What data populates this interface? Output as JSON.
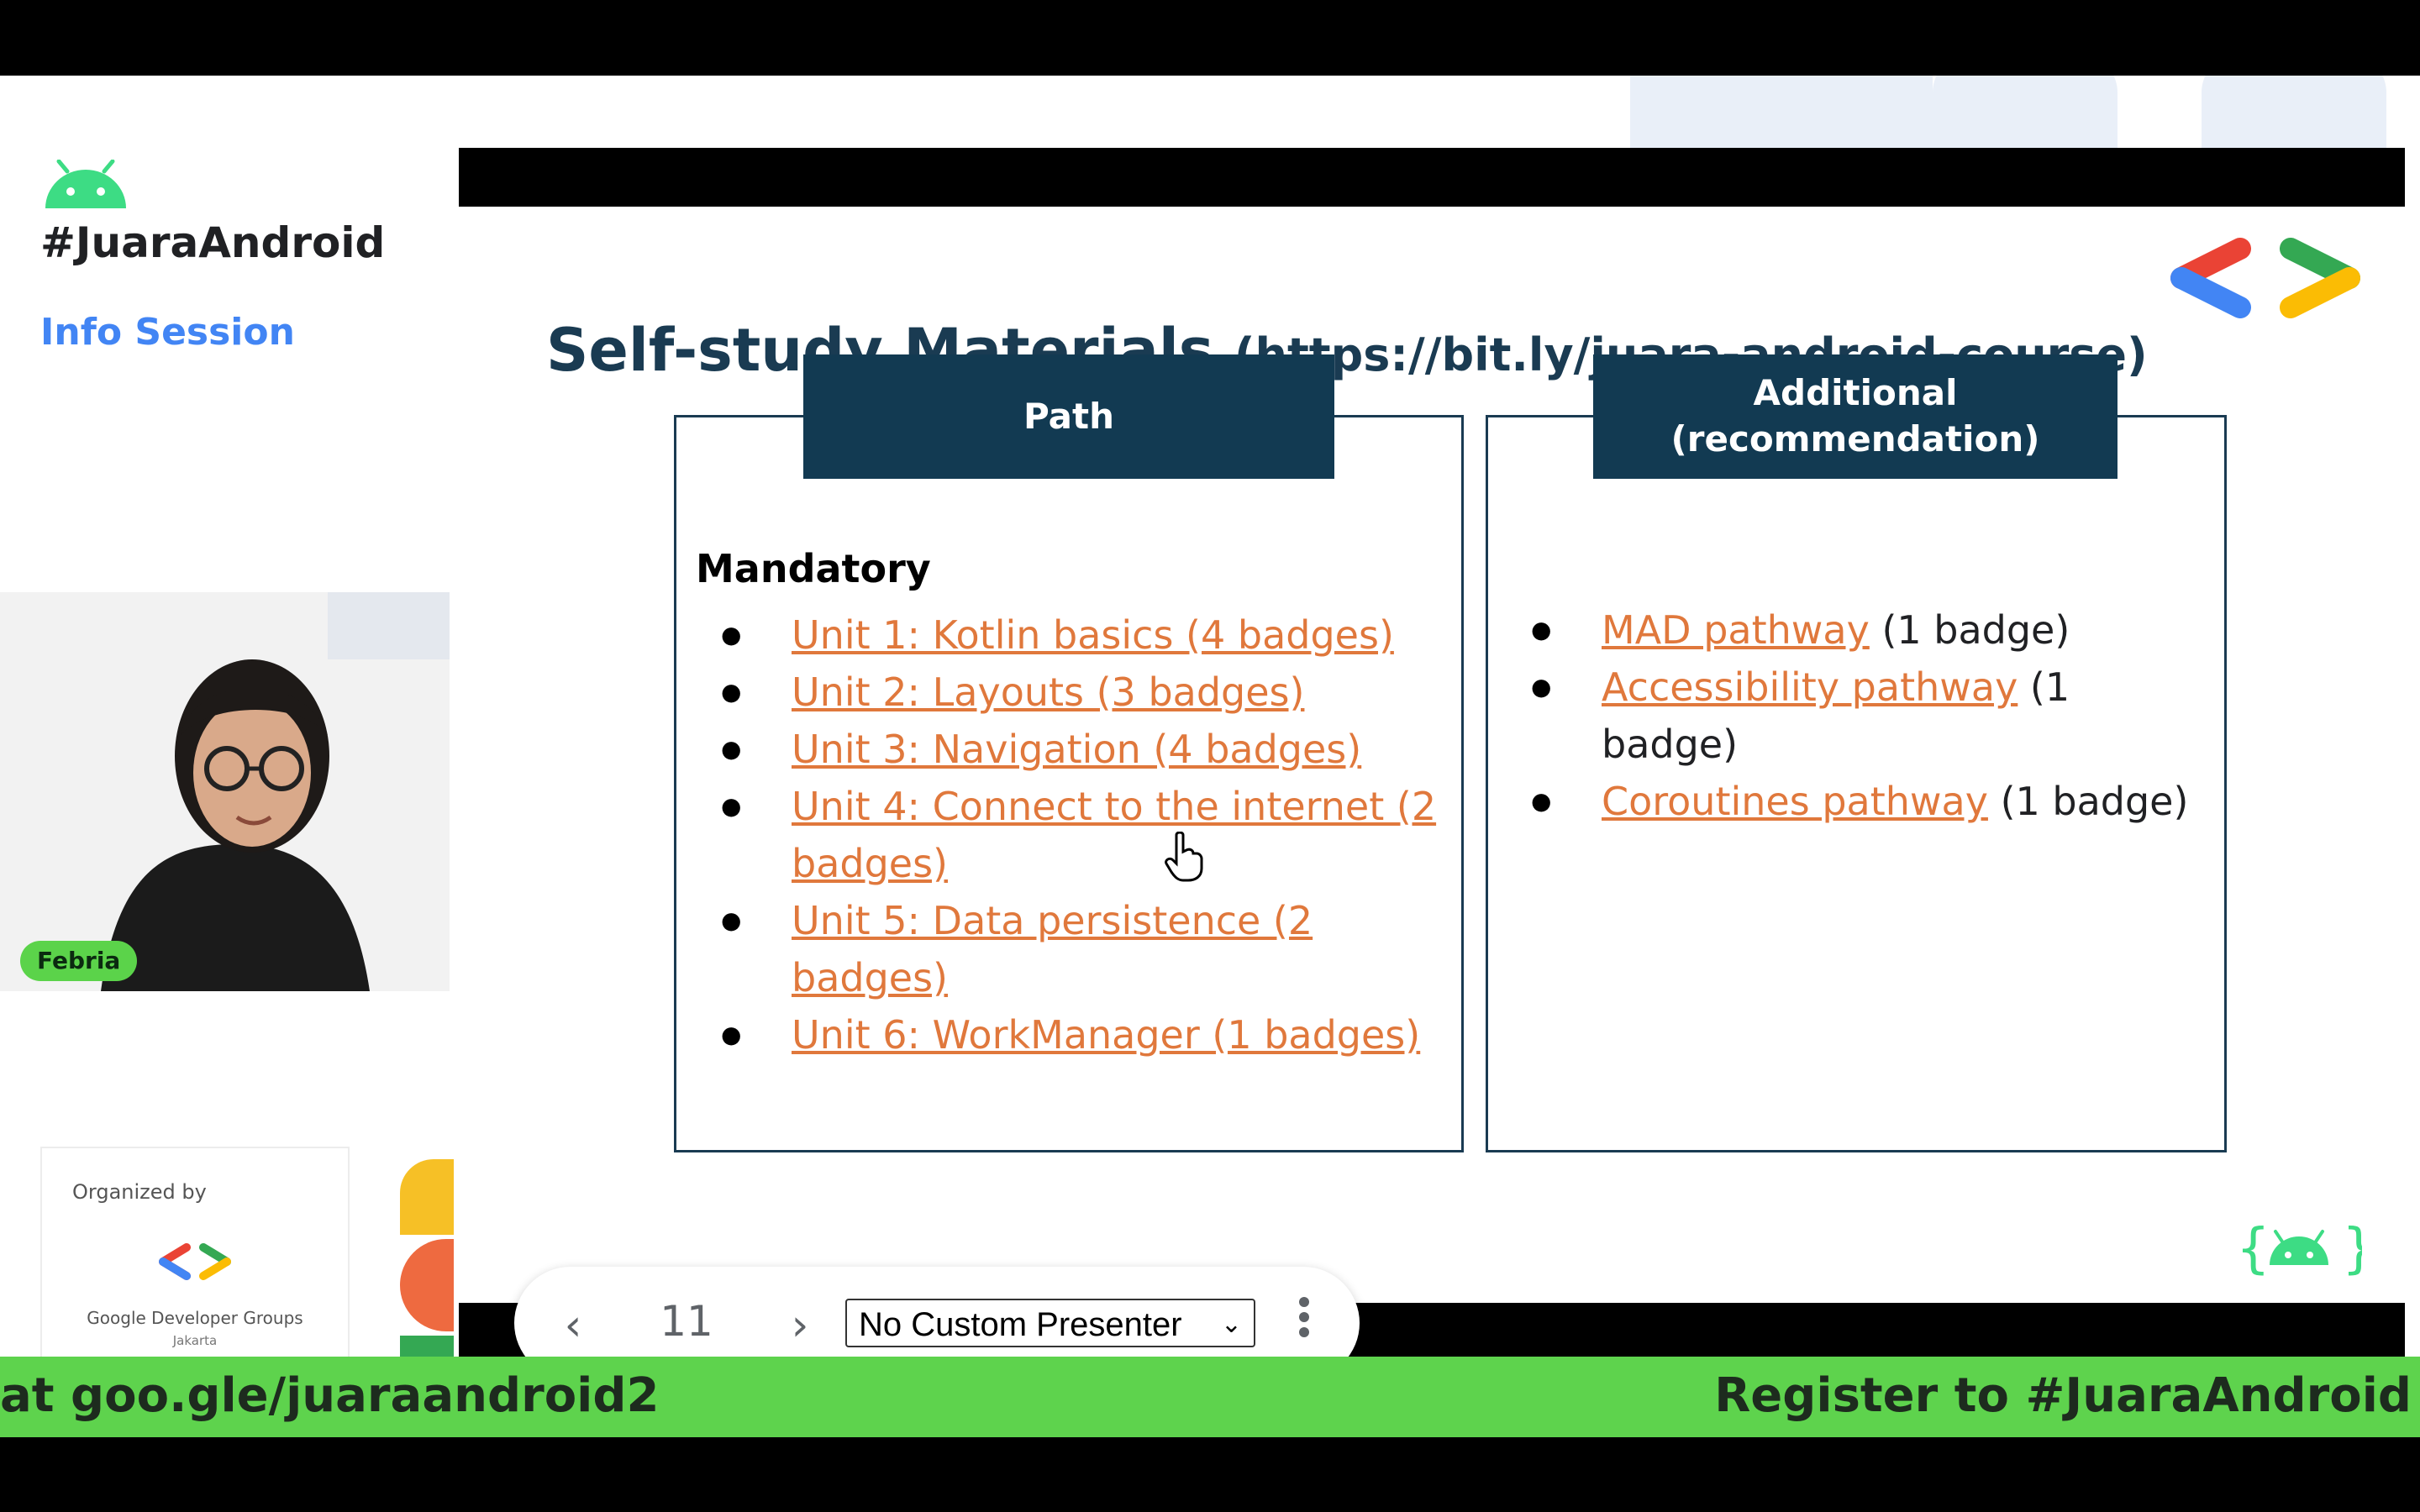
{
  "sidebar": {
    "brand": "#JuaraAndroid",
    "subtitle": "Info Session",
    "participant_name": "Febria",
    "organized_by_label": "Organized by",
    "organizer_name": "Google Developer Groups",
    "organizer_city": "Jakarta"
  },
  "slide": {
    "title": "Self-study Materials",
    "title_url": "(https://bit.ly/juara-android-course)",
    "path_panel": {
      "header": "Path",
      "section_label": "Mandatory",
      "items": [
        "Unit 1: Kotlin basics (4 badges)",
        "Unit 2: Layouts (3 badges)",
        "Unit 3: Navigation (4 badges)",
        "Unit 4: Connect to the internet (2 badges)",
        "Unit 5: Data persistence (2 badges)",
        "Unit 6: WorkManager (1 badges)"
      ]
    },
    "additional_panel": {
      "header_line1": "Additional",
      "header_line2": "(recommendation)",
      "items": [
        {
          "link": "MAD pathway",
          "note": "(1 badge)"
        },
        {
          "link": "Accessibility pathway",
          "note": "(1 badge)"
        },
        {
          "link": "Coroutines pathway",
          "note": "(1 badge)"
        }
      ]
    }
  },
  "presenter_toolbar": {
    "prev_icon": "chevron-left-icon",
    "page_number": "11",
    "next_icon": "chevron-right-icon",
    "presenter_select": "No Custom Presenter",
    "more_icon": "more-vertical-icon"
  },
  "ticker": {
    "left_text": "at goo.gle/juaraandroid2",
    "right_text": "Register to #JuaraAndroid"
  },
  "colors": {
    "header_navy": "#123a52",
    "link_orange": "#e0783c",
    "ticker_green": "#5ed34d",
    "accent_blue": "#4285f4"
  }
}
